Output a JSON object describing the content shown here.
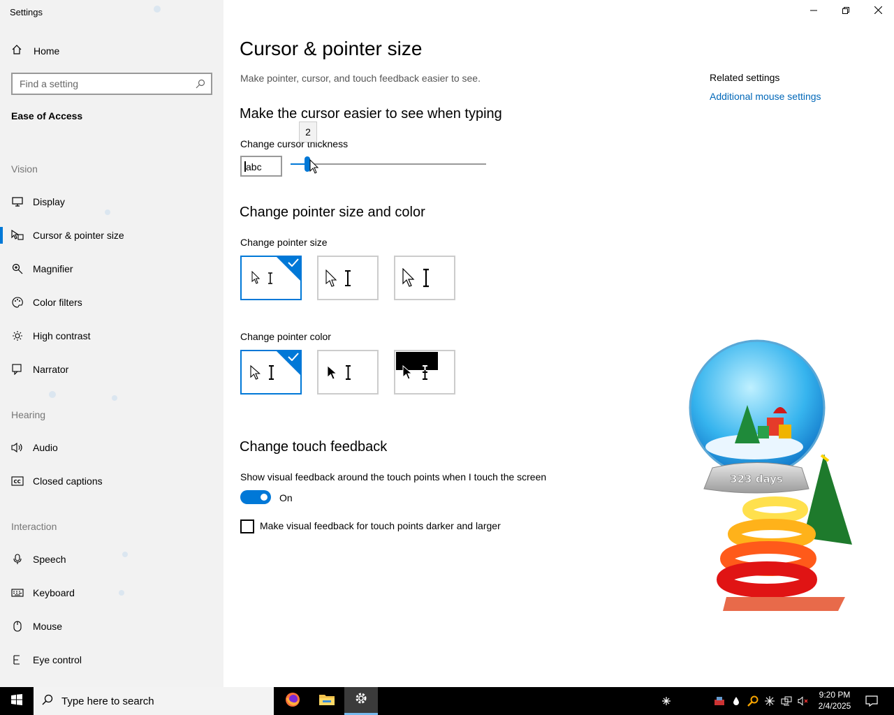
{
  "window": {
    "title": "Settings"
  },
  "sidebar": {
    "home_label": "Home",
    "search_placeholder": "Find a setting",
    "section_title": "Ease of Access",
    "groups": [
      "Vision",
      "Hearing",
      "Interaction"
    ],
    "items": [
      {
        "label": "Display",
        "icon": "monitor-icon"
      },
      {
        "label": "Cursor & pointer size",
        "icon": "cursor-pointer-icon",
        "active": true
      },
      {
        "label": "Magnifier",
        "icon": "magnifier-icon"
      },
      {
        "label": "Color filters",
        "icon": "color-palette-icon"
      },
      {
        "label": "High contrast",
        "icon": "brightness-icon"
      },
      {
        "label": "Narrator",
        "icon": "narrator-icon"
      },
      {
        "label": "Audio",
        "icon": "speaker-icon"
      },
      {
        "label": "Closed captions",
        "icon": "cc-icon"
      },
      {
        "label": "Speech",
        "icon": "microphone-icon"
      },
      {
        "label": "Keyboard",
        "icon": "keyboard-icon"
      },
      {
        "label": "Mouse",
        "icon": "mouse-icon"
      },
      {
        "label": "Eye control",
        "icon": "eye-icon"
      }
    ]
  },
  "main": {
    "title": "Cursor & pointer size",
    "subtitle": "Make pointer, cursor, and touch feedback easier to see.",
    "typing_heading": "Make the cursor easier to see when typing",
    "thickness_label": "Change cursor thickness",
    "thickness_preview": "abc",
    "thickness_value": "2",
    "pointer_heading": "Change pointer size and color",
    "size_label": "Change pointer size",
    "size_selected_index": 0,
    "color_label": "Change pointer color",
    "color_selected_index": 0,
    "touch_heading": "Change touch feedback",
    "touch_desc": "Show visual feedback around the touch points when I touch the screen",
    "toggle_state": "On",
    "checkbox_label": "Make visual feedback for touch points darker and larger",
    "checkbox_checked": false
  },
  "related": {
    "heading": "Related settings",
    "link": "Additional mouse settings"
  },
  "widget": {
    "countdown": "323 days"
  },
  "taskbar": {
    "search_placeholder": "Type here to search",
    "time": "9:20 PM",
    "date": "2/4/2025"
  },
  "colors": {
    "accent": "#0078d7",
    "link": "#0067b8"
  }
}
